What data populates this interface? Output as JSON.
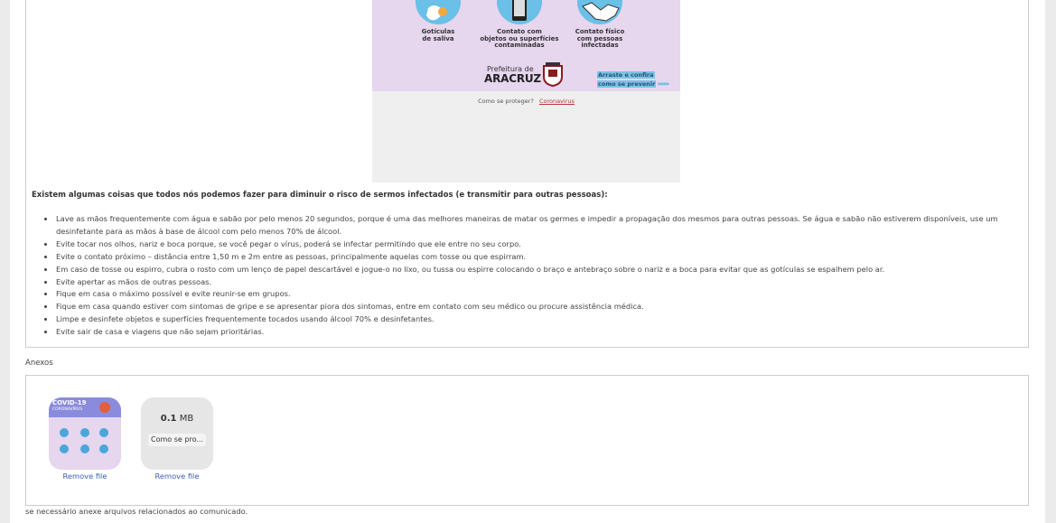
{
  "poster": {
    "cap1": [
      "Gotículas",
      "de saliva"
    ],
    "cap2": [
      "Contato com",
      "objetos ou superfícies",
      "contaminadas"
    ],
    "cap3": [
      "Contato físico",
      "com pessoas",
      "infectadas"
    ],
    "pref_small": "Prefeitura de",
    "pref_big": "ARACRUZ",
    "cta_line1": "Arraste e confira",
    "cta_line2": "como se prevenir",
    "arrows": "▸▸▸▸",
    "caption": "Como se proteger?",
    "caption_link": "Coronavirus"
  },
  "content": {
    "intro": "Existem algumas coisas que todos nós podemos fazer para diminuir o risco de sermos infectados (e transmitir para outras pessoas):",
    "tips": [
      "Lave as mãos frequentemente com água e sabão por pelo menos 20 segundos, porque é uma das melhores maneiras de matar os germes e impedir a propagação dos mesmos para outras pessoas. Se água e sabão não estiverem disponíveis, use um desinfetante para as mãos à base de álcool com pelo menos 70% de álcool.",
      "Evite tocar nos olhos, nariz e boca porque, se você pegar o vírus, poderá se infectar permitindo que ele entre no seu corpo.",
      "Evite o contato próximo – distância entre 1,50 m e 2m entre as pessoas, principalmente aquelas com tosse ou que espirram.",
      "Em caso de tosse ou espirro, cubra o rosto com um lenço de papel descartável e jogue-o no lixo, ou tussa ou espirre colocando o braço e antebraço sobre o nariz e a boca para evitar que as gotículas se espalhem pelo ar.",
      "Evite apertar as mãos de outras pessoas.",
      "Fique em casa o máximo possível e evite reunir-se em grupos.",
      "Fique em casa quando estiver com sintomas de gripe e se apresentar piora dos sintomas, entre em contato com seu médico ou procure assistência médica.",
      "Limpe e desinfete objetos e superfícies frequentemente tocados usando álcool 70% e desinfetantes.",
      "Evite sair de casa e viagens que não sejam prioritárias."
    ]
  },
  "attachments": {
    "label": "Anexos",
    "thumb_title": "COVID-19",
    "thumb_sub": "CORONAVÍRUS",
    "file2_size_num": "0.1",
    "file2_size_unit": "MB",
    "file2_name": "Como se pro...",
    "remove_label": "Remove file",
    "hint": "se necessário anexe arquivos relacionados ao comunicado."
  },
  "colors": {
    "poster_bg": "#e6d6ee",
    "icon_blue": "#6ac0e6",
    "link_blue": "#3c5bbf"
  }
}
